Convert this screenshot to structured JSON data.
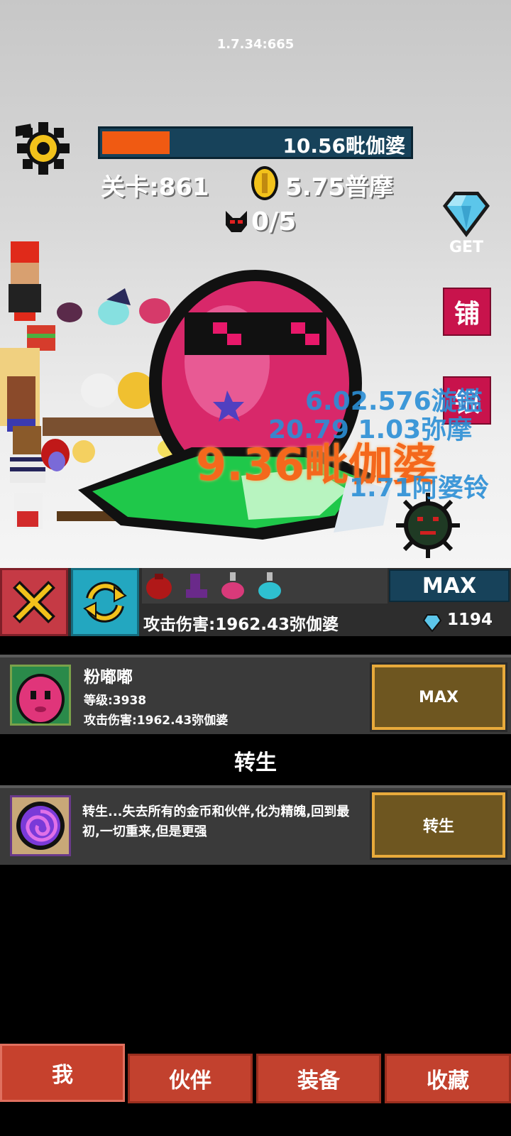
{
  "version": "1.7.34:665",
  "hud": {
    "boss_hp_text": "10.56毗伽婆",
    "boss_hp_fraction": 0.22,
    "level_text": "关卡:861",
    "coins_text": "5.75普摩",
    "kills_text": "0/5",
    "get_label": "GET",
    "shop_button": "铺",
    "bank_button": "银"
  },
  "damage_numbers": [
    {
      "text": "9.36毗伽婆",
      "style": "orange"
    },
    {
      "text": "6.02.576漩鑑",
      "style": "blue"
    },
    {
      "text": "20.79 1.03弥摩",
      "style": "blue"
    },
    {
      "text": "1.71阿婆铃",
      "style": "blue"
    }
  ],
  "toolbar": {
    "max_label": "MAX",
    "attack_text": "攻击伤害:1962.43弥伽婆",
    "gem_count": "1194",
    "items": [
      "potion-bag-icon",
      "boot-icon",
      "pink-flask-icon",
      "cyan-flask-icon"
    ]
  },
  "hero": {
    "name": "粉嘟嘟",
    "level_text": "等级:3938",
    "attack_text": "攻击伤害:1962.43弥伽婆",
    "button_label": "MAX"
  },
  "rebirth": {
    "section_title": "转生",
    "description": "转生...失去所有的金币和伙伴,化为精魄,回到最初,一切重来,但是更强",
    "button_label": "转生"
  },
  "nav": {
    "tabs": [
      {
        "label": "我",
        "active": true
      },
      {
        "label": "伙伴",
        "active": false
      },
      {
        "label": "装备",
        "active": false
      },
      {
        "label": "收藏",
        "active": false
      }
    ]
  },
  "colors": {
    "hp_fill": "#f05a12",
    "hp_bar": "#17425a",
    "side_button": "#c8134c",
    "brown_button": "#6e5620",
    "button_border": "#e8aa3b",
    "tab_red": "#c2412e",
    "damage_orange": "#f4681c",
    "damage_blue": "#2b8fd6"
  }
}
